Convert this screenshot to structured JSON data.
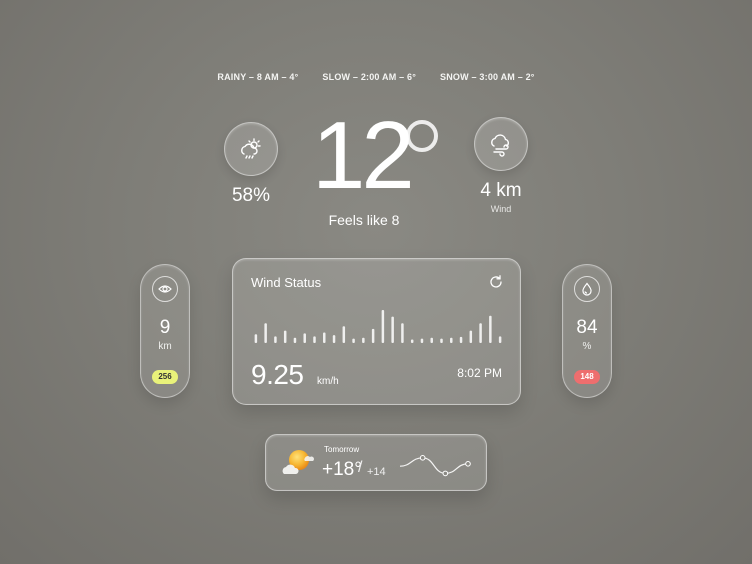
{
  "forecast": [
    {
      "condition": "RAINY",
      "time": "8 AM",
      "temp": "4°",
      "text": "RAINY – 8 AM – 4°"
    },
    {
      "condition": "SLOW",
      "time": "2:00 AM",
      "temp": "6°",
      "text": "SLOW – 2:00 AM – 6°"
    },
    {
      "condition": "SNOW",
      "time": "3:00 AM",
      "temp": "2°",
      "text": "SNOW – 3:00 AM – 2°"
    }
  ],
  "current": {
    "temperature": "12",
    "feels_like": "Feels like 8",
    "precipitation": "58%",
    "precipitation_icon": "cloud-sun-rain-icon",
    "wind_distance": "4 km",
    "wind_label": "Wind",
    "wind_icon": "cloud-wind-icon"
  },
  "visibility": {
    "icon": "eye-icon",
    "value": "9",
    "unit": "km",
    "badge": "256",
    "badge_color": "#e9f27a"
  },
  "humidity": {
    "icon": "droplet-icon",
    "value": "84",
    "unit": "%",
    "badge": "148",
    "badge_color": "#ee6e6e"
  },
  "wind_status": {
    "title": "Wind Status",
    "refresh_icon": "refresh-icon",
    "bar_levels": [
      0.2,
      0.45,
      0.15,
      0.28,
      0.12,
      0.22,
      0.15,
      0.24,
      0.18,
      0.38,
      0.1,
      0.12,
      0.32,
      0.75,
      0.6,
      0.45,
      0.08,
      0.1,
      0.12,
      0.1,
      0.12,
      0.14,
      0.28,
      0.45,
      0.62,
      0.15
    ],
    "speed": "9.25",
    "unit": "km/h",
    "time": "8:02 PM"
  },
  "tomorrow": {
    "label": "Tomorrow",
    "high": "+18°",
    "sep": "/",
    "low": "+14",
    "icon": "sun-cloud-icon",
    "trend": [
      0.55,
      0.2,
      0.85,
      0.45
    ]
  }
}
